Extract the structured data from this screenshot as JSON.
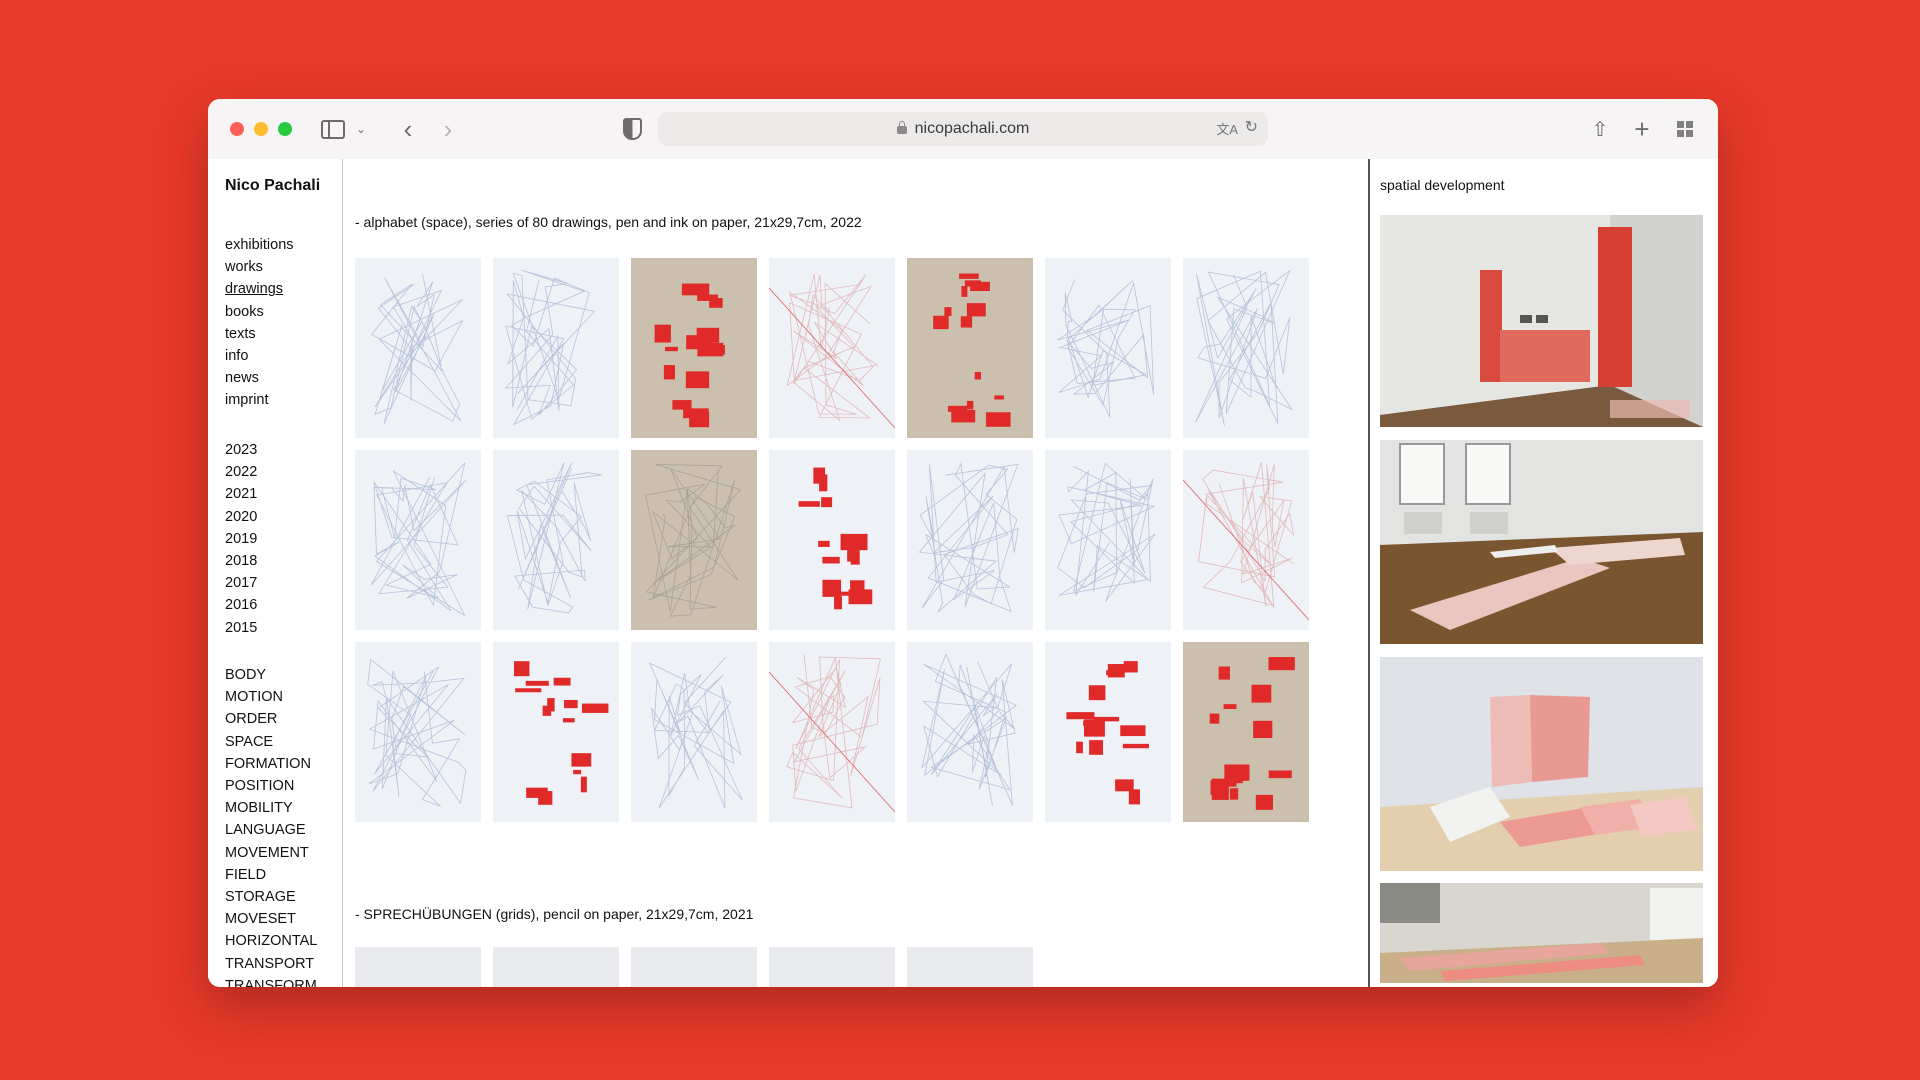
{
  "browser": {
    "url": "nicopachali.com"
  },
  "site": {
    "title": "Nico Pachali",
    "nav": [
      {
        "label": "exhibitions"
      },
      {
        "label": "works"
      },
      {
        "label": "drawings",
        "active": true
      },
      {
        "label": "books"
      },
      {
        "label": "texts"
      },
      {
        "label": "info"
      },
      {
        "label": "news"
      },
      {
        "label": "imprint"
      }
    ],
    "years": [
      "2023",
      "2022",
      "2021",
      "2020",
      "2019",
      "2018",
      "2017",
      "2016",
      "2015"
    ],
    "topics": [
      "BODY",
      "MOTION",
      "ORDER",
      "SPACE",
      "FORMATION",
      "POSITION",
      "MOBILITY",
      "LANGUAGE",
      "MOVEMENT",
      "FIELD",
      "STORAGE",
      "MOVESET",
      "HORIZONTAL",
      "TRANSPORT",
      "TRANSFORM"
    ]
  },
  "main": {
    "sections": [
      {
        "heading": "- alphabet (space), series of 80 drawings, pen and ink on paper, 21x29,7cm, 2022"
      },
      {
        "heading": "- SPRECHÜBUNGEN (grids), pencil on paper, 21x29,7cm, 2021"
      }
    ]
  },
  "aside": {
    "title": "spatial development"
  },
  "colors": {
    "background": "#e8392a",
    "ink_red": "#e02a2a",
    "pencil_blue": "#8a9bc4"
  }
}
